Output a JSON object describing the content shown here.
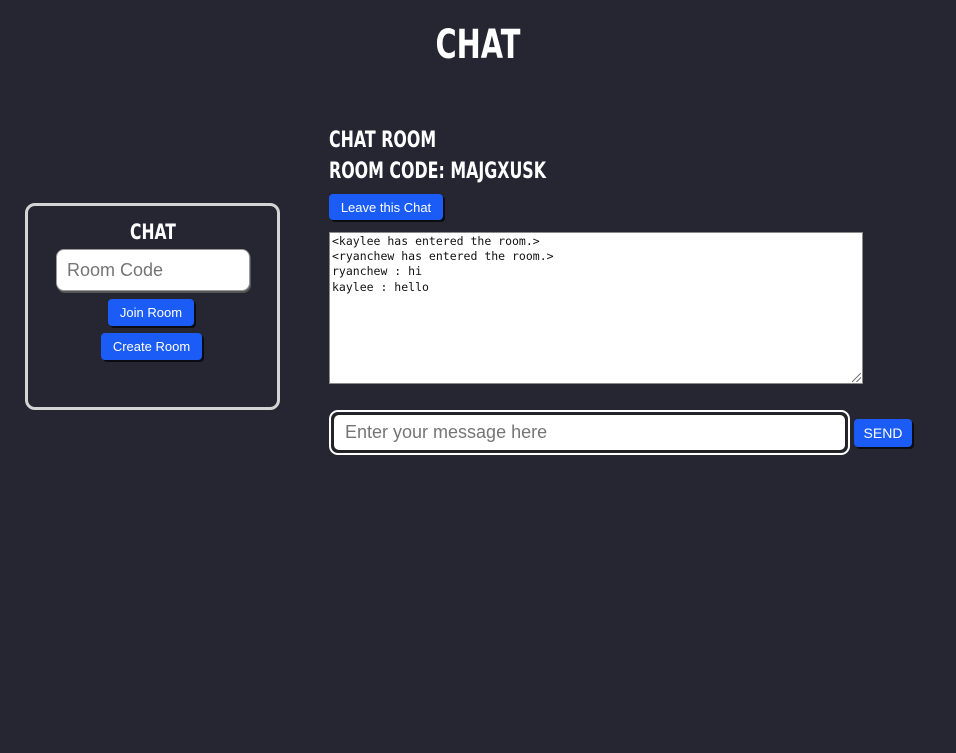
{
  "app": {
    "title": "CHAT"
  },
  "join_panel": {
    "title": "CHAT",
    "room_code_placeholder": "Room Code",
    "room_code_value": "",
    "join_label": "Join Room",
    "create_label": "Create Room"
  },
  "chat_room": {
    "heading": "CHAT ROOM",
    "room_code_line": "ROOM CODE: MAJGXUSK",
    "leave_label": "Leave this Chat",
    "log": [
      "<kaylee has entered the room.>",
      "<ryanchew has entered the room.>",
      "ryanchew : hi",
      "kaylee : hello"
    ],
    "message_placeholder": "Enter your message here",
    "message_value": "",
    "send_label": "SEND"
  },
  "colors": {
    "background": "#252632",
    "accent": "#1a5cf5",
    "text": "#ffffff"
  }
}
